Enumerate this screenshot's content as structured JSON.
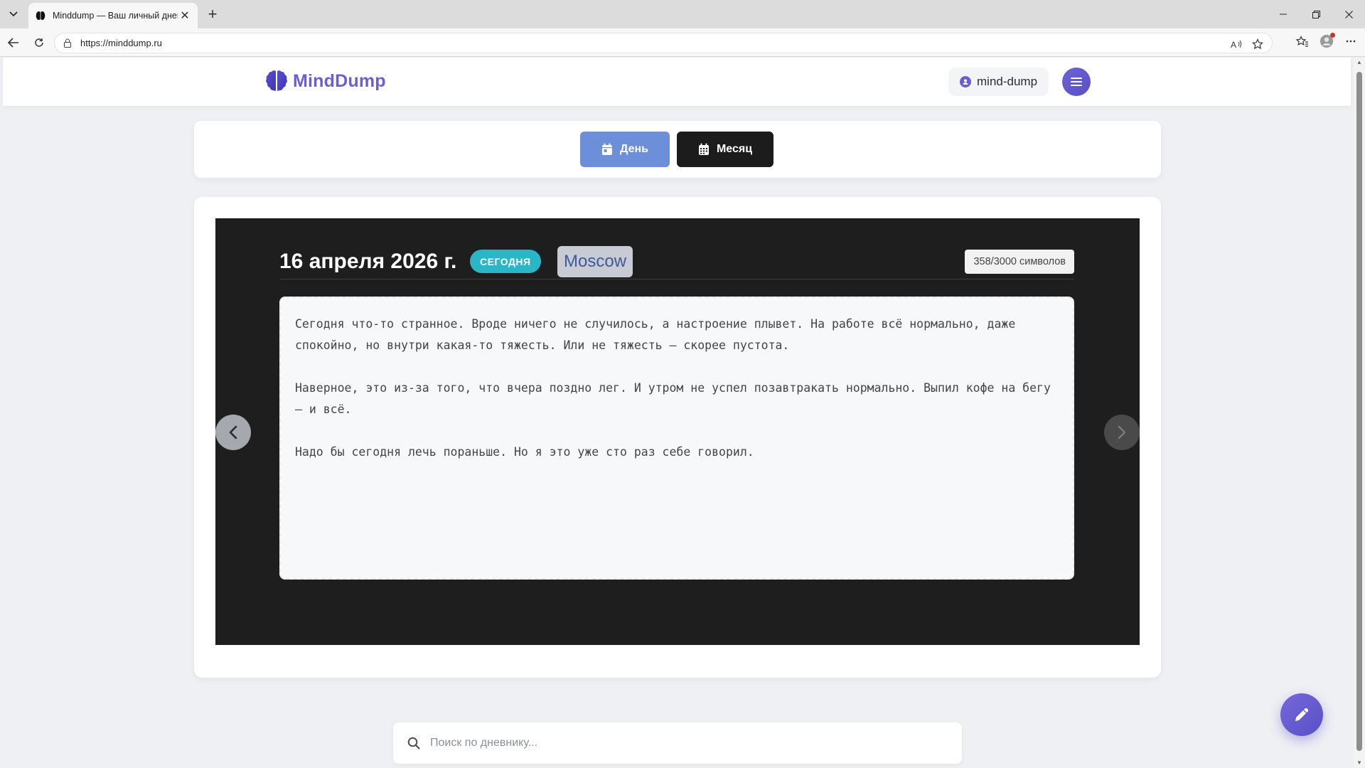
{
  "browser": {
    "tab_title": "Minddump — Ваш личный дневн",
    "url": "https://minddump.ru"
  },
  "header": {
    "logo_text": "MindDump",
    "username": "mind-dump"
  },
  "view_switch": {
    "day_label": "День",
    "month_label": "Месяц"
  },
  "entry": {
    "date": "16 апреля 2026 г.",
    "today_badge": "СЕГОДНЯ",
    "city": "Moscow",
    "char_counter": "358/3000 символов",
    "paragraphs": [
      "Сегодня что-то странное. Вроде ничего не случилось, а настроение плывет. На работе всё нормально, даже спокойно, но внутри какая-то тяжесть. Или не тяжесть — скорее пустота.",
      "Наверное, это из-за того, что вчера поздно лег. И утром не успел позавтракать нормально. Выпил кофе на бегу — и всё.",
      "Надо бы сегодня лечь пораньше. Но я это уже сто раз себе говорил."
    ]
  },
  "search": {
    "placeholder": "Поиск по дневнику..."
  },
  "colors": {
    "brand": "#6a5fd0",
    "day_button": "#6d8ed9",
    "month_button": "#1c1c1c",
    "today_badge": "#29b6c6",
    "entry_background": "#1e1e1e"
  },
  "icons": {
    "logo": "brain-icon",
    "user": "user-circle-icon",
    "menu": "hamburger-icon",
    "day": "calendar-day-icon",
    "month": "calendar-icon",
    "prev": "chevron-left-icon",
    "next": "chevron-right-icon",
    "search": "search-icon",
    "fab": "pencil-icon"
  }
}
